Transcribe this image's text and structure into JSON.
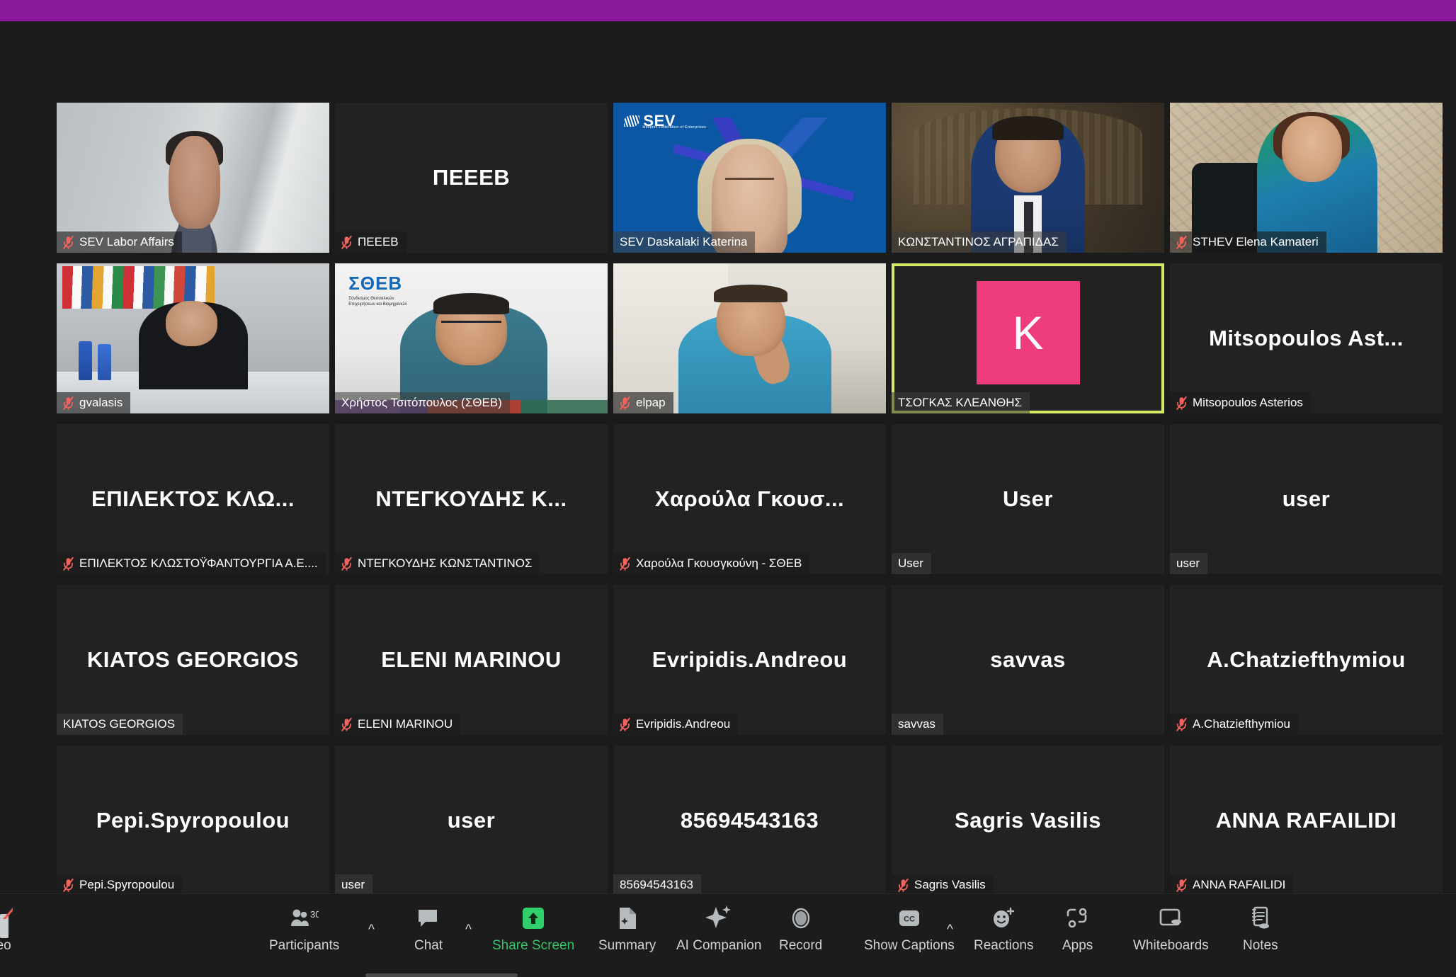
{
  "app": {
    "name": "Zoom Meeting",
    "top_bar_color": "#8a1a9b"
  },
  "gallery": {
    "active_speaker_border_color": "#d7e866",
    "avatar_color": "#ee3c7f",
    "tiles": [
      {
        "name": "SEV Labor Affairs",
        "display_name": "SEV Labor Affairs",
        "muted": true,
        "video": true,
        "big_name": ""
      },
      {
        "name": "ΠΕΕΕΒ",
        "display_name": "ΠΕΕΕΒ",
        "muted": true,
        "video": false,
        "big_name": "ΠΕΕΕΒ"
      },
      {
        "name": "SEV Daskalaki Katerina",
        "display_name": "SEV Daskalaki Katerina",
        "muted": false,
        "video": true,
        "big_name": ""
      },
      {
        "name": "ΚΩΝΣΤΑΝΤΙΝΟΣ ΑΓΡΑΠΙΔΑΣ",
        "display_name": "ΚΩΝΣΤΑΝΤΙΝΟΣ ΑΓΡΑΠΙΔΑΣ",
        "muted": false,
        "video": true,
        "big_name": ""
      },
      {
        "name": "STHEV Elena Kamateri",
        "display_name": "STHEV Elena Kamateri",
        "muted": true,
        "video": true,
        "big_name": ""
      },
      {
        "name": "gvalasis",
        "display_name": "gvalasis",
        "muted": true,
        "video": true,
        "big_name": ""
      },
      {
        "name": "Χρήστος Τσιτόπουλος (ΣΘΕΒ)",
        "display_name": "Χρήστος Τσιτόπουλος (ΣΘΕΒ)",
        "muted": false,
        "video": true,
        "big_name": ""
      },
      {
        "name": "elpap",
        "display_name": "elpap",
        "muted": true,
        "video": true,
        "big_name": ""
      },
      {
        "name": "ΤΣΟΓΚΑΣ ΚΛΕΑΝΘΗΣ",
        "display_name": "ΤΣΟΓΚΑΣ ΚΛΕΑΝΘΗΣ",
        "muted": false,
        "video": false,
        "big_name": "",
        "avatar_letter": "K",
        "active_speaker": true
      },
      {
        "name": "Mitsopoulos Asterios",
        "display_name": "Mitsopoulos Asterios",
        "muted": true,
        "video": false,
        "big_name": "Mitsopoulos  Ast..."
      },
      {
        "name": "ΕΠΙΛΕΚΤΟΣ ΚΛΩΣΤΟΫΦΑΝΤΟΥΡΓΙΑ Α.Ε....",
        "display_name": "ΕΠΙΛΕΚΤΟΣ ΚΛΩΣΤΟΫΦΑΝΤΟΥΡΓΙΑ Α.Ε....",
        "muted": true,
        "video": false,
        "big_name": "ΕΠΙΛΕΚΤΟΣ  ΚΛΩ..."
      },
      {
        "name": "ΝΤΕΓΚΟΥΔΗΣ ΚΩΝΣΤΑΝΤΙΝΟΣ",
        "display_name": "ΝΤΕΓΚΟΥΔΗΣ ΚΩΝΣΤΑΝΤΙΝΟΣ",
        "muted": true,
        "video": false,
        "big_name": "ΝΤΕΓΚΟΥΔΗΣ  Κ..."
      },
      {
        "name": "Χαρούλα Γκουσγκούνη - ΣΘΕΒ",
        "display_name": "Χαρούλα Γκουσγκούνη - ΣΘΕΒ",
        "muted": true,
        "video": false,
        "big_name": "Χαρούλα Γκουσ..."
      },
      {
        "name": "User",
        "display_name": "User",
        "muted": false,
        "video": false,
        "big_name": "User"
      },
      {
        "name": "user",
        "display_name": "user",
        "muted": false,
        "video": false,
        "big_name": "user"
      },
      {
        "name": "KIATOS GEORGIOS",
        "display_name": "KIATOS GEORGIOS",
        "muted": false,
        "video": false,
        "big_name": "KIATOS GEORGIOS"
      },
      {
        "name": "ELENI MARINOU",
        "display_name": "ELENI MARINOU",
        "muted": true,
        "video": false,
        "big_name": "ELENI MARINOU"
      },
      {
        "name": "Evripidis.Andreou",
        "display_name": "Evripidis.Andreou",
        "muted": true,
        "video": false,
        "big_name": "Evripidis.Andreou"
      },
      {
        "name": "savvas",
        "display_name": "savvas",
        "muted": false,
        "video": false,
        "big_name": "savvas"
      },
      {
        "name": "A.Chatziefthymiou",
        "display_name": "A.Chatziefthymiou",
        "muted": true,
        "video": false,
        "big_name": "A.Chatziefthymiou"
      },
      {
        "name": "Pepi.Spyropoulou",
        "display_name": "Pepi.Spyropoulou",
        "muted": true,
        "video": false,
        "big_name": "Pepi.Spyropoulou"
      },
      {
        "name": "user",
        "display_name": "user",
        "muted": false,
        "video": false,
        "big_name": "user"
      },
      {
        "name": "85694543163",
        "display_name": "85694543163",
        "muted": false,
        "video": false,
        "big_name": "85694543163"
      },
      {
        "name": "Sagris Vasilis",
        "display_name": "Sagris Vasilis",
        "muted": true,
        "video": false,
        "big_name": "Sagris Vasilis"
      },
      {
        "name": "ANNA RAFAILIDI",
        "display_name": "ANNA RAFAILIDI",
        "muted": true,
        "video": false,
        "big_name": "ANNA RAFAILIDI"
      }
    ]
  },
  "tile_art": {
    "sev_logo_text": "SEV",
    "sev_logo_sub": "Hellenic Federation of Enterprises",
    "stheb_logo_text": "ΣΘΕΒ",
    "stheb_logo_sub": "Σύνδεσμος Θεσσαλικών\nΕπιχειρήσεων και Βιομηχανιών"
  },
  "toolbar": {
    "video_label_cut": "deo",
    "participants_label": "Participants",
    "participants_count": "30",
    "chat_label": "Chat",
    "share_screen_label": "Share Screen",
    "share_screen_color": "#36c46a",
    "summary_label": "Summary",
    "ai_companion_label": "AI Companion",
    "record_label": "Record",
    "show_captions_label": "Show Captions",
    "captions_badge": "CC",
    "reactions_label": "Reactions",
    "apps_label": "Apps",
    "whiteboards_label": "Whiteboards",
    "notes_label": "Notes",
    "caret_glyph": "^"
  }
}
